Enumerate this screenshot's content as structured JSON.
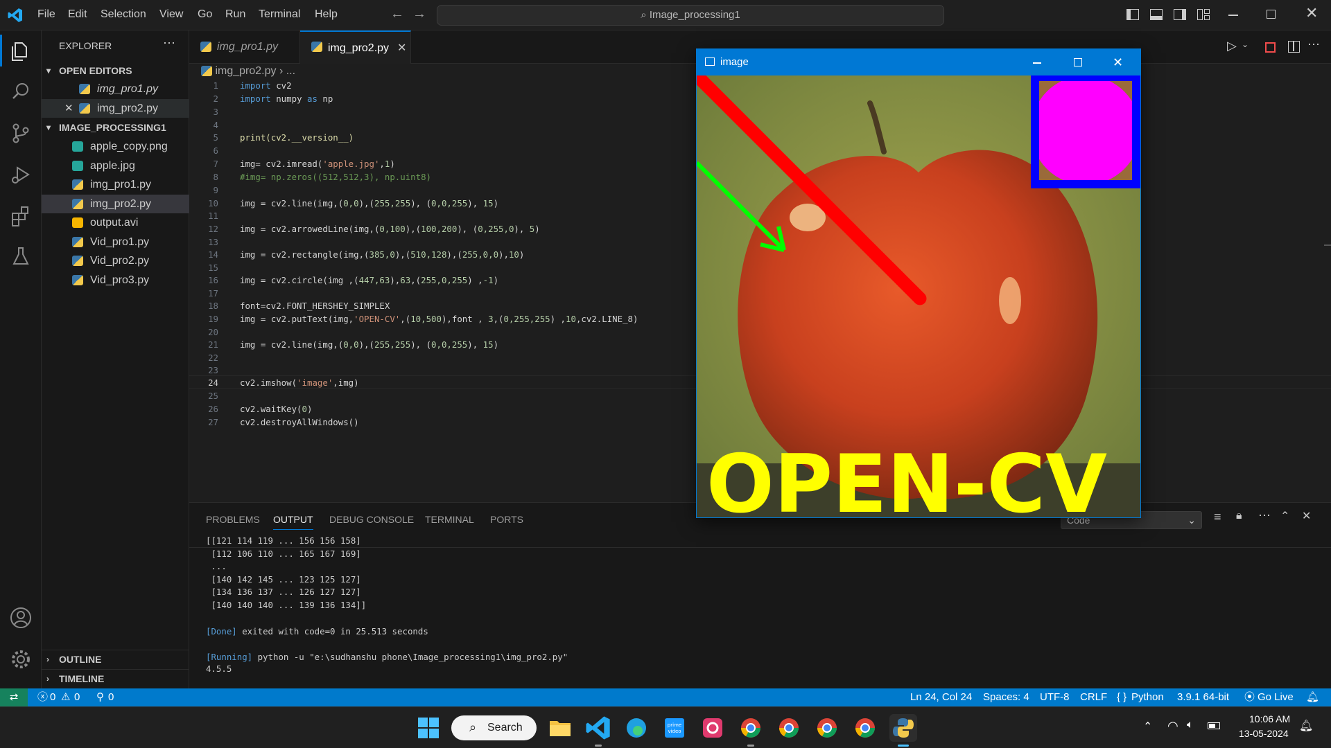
{
  "titlebar": {
    "menu": [
      "File",
      "Edit",
      "Selection",
      "View",
      "Go",
      "Run",
      "Terminal",
      "Help"
    ],
    "search_text": "Image_processing1"
  },
  "sidebar": {
    "header": "EXPLORER",
    "open_editors_label": "OPEN EDITORS",
    "open_editors": [
      "img_pro1.py",
      "img_pro2.py"
    ],
    "project_label": "IMAGE_PROCESSING1",
    "files": [
      "apple_copy.png",
      "apple.jpg",
      "img_pro1.py",
      "img_pro2.py",
      "output.avi",
      "Vid_pro1.py",
      "Vid_pro2.py",
      "Vid_pro3.py"
    ],
    "outline_label": "OUTLINE",
    "timeline_label": "TIMELINE"
  },
  "tabs": [
    {
      "label": "img_pro1.py"
    },
    {
      "label": "img_pro2.py"
    }
  ],
  "breadcrumb": {
    "file": "img_pro2.py",
    "rest": "..."
  },
  "code_lines": [
    {
      "n": "1"
    },
    {
      "n": "2"
    },
    {
      "n": "3"
    },
    {
      "n": "4"
    },
    {
      "n": "5"
    },
    {
      "n": "6"
    },
    {
      "n": "7"
    },
    {
      "n": "8"
    },
    {
      "n": "9"
    },
    {
      "n": "10"
    },
    {
      "n": "11"
    },
    {
      "n": "12"
    },
    {
      "n": "13"
    },
    {
      "n": "14"
    },
    {
      "n": "15"
    },
    {
      "n": "16"
    },
    {
      "n": "17"
    },
    {
      "n": "18"
    },
    {
      "n": "19"
    },
    {
      "n": "20"
    },
    {
      "n": "21"
    },
    {
      "n": "22"
    },
    {
      "n": "23"
    },
    {
      "n": "24"
    },
    {
      "n": "25"
    },
    {
      "n": "26"
    },
    {
      "n": "27"
    }
  ],
  "code": {
    "l1a": "import",
    "l1b": " cv2",
    "l2a": "import",
    "l2b": " numpy ",
    "l2c": "as",
    "l2d": " np",
    "l5": "print(cv2.__version__)",
    "l7a": "img= cv2.imread(",
    "l7b": "'apple.jpg'",
    "l7c": ",",
    "l7d": "1",
    "l7e": ")",
    "l8": "#img= np.zeros((512,512,3), np.uint8)",
    "l10a": "img = cv2.line(img,(",
    "l10b": "0,0",
    "l10c": "),(",
    "l10d": "255,255",
    "l10e": "), (",
    "l10f": "0,0,255",
    "l10g": "), ",
    "l10h": "15",
    "l10i": ")",
    "l12a": "img = cv2.arrowedLine(img,(",
    "l12b": "0,100",
    "l12c": "),(",
    "l12d": "100,200",
    "l12e": "), (",
    "l12f": "0,255,0",
    "l12g": "), ",
    "l12h": "5",
    "l12i": ")",
    "l14a": "img = cv2.rectangle(img,(",
    "l14b": "385,0",
    "l14c": "),(",
    "l14d": "510,128",
    "l14e": "),(",
    "l14f": "255,0,0",
    "l14g": "),",
    "l14h": "10",
    "l14i": ")",
    "l16a": "img = cv2.circle(img ,(",
    "l16b": "447,63",
    "l16c": "),",
    "l16d": "63",
    "l16e": ",(",
    "l16f": "255,0,255",
    "l16g": ") ,",
    "l16h": "-1",
    "l16i": ")",
    "l18": "font=cv2.FONT_HERSHEY_SIMPLEX",
    "l19a": "img = cv2.putText(img,",
    "l19b": "'OPEN-CV'",
    "l19c": ",(",
    "l19d": "10,500",
    "l19e": "),font , ",
    "l19f": "3",
    "l19g": ",(",
    "l19h": "0,255,255",
    "l19i": ") ,",
    "l19j": "10",
    "l19k": ",cv2.LINE_8)",
    "l21a": "img = cv2.line(img,(",
    "l21b": "0,0",
    "l21c": "),(",
    "l21d": "255,255",
    "l21e": "), (",
    "l21f": "0,0,255",
    "l21g": "), ",
    "l21h": "15",
    "l21i": ")",
    "l24a": "cv2.imshow(",
    "l24b": "'image'",
    "l24c": ",img)",
    "l26a": "cv2.waitKey(",
    "l26b": "0",
    "l26c": ")",
    "l27": "cv2.destroyAllWindows()"
  },
  "panel": {
    "tabs": [
      "PROBLEMS",
      "OUTPUT",
      "DEBUG CONSOLE",
      "TERMINAL",
      "PORTS"
    ],
    "dropdown": "Code",
    "output_lines": [
      "[[121 114 119 ... 156 156 158]",
      " [112 106 110 ... 165 167 169]",
      " ...",
      " [140 142 145 ... 123 125 127]",
      " [134 136 137 ... 126 127 127]",
      " [140 140 140 ... 139 136 134]]",
      "",
      "",
      "",
      "",
      "4.5.5"
    ],
    "done_tag": "[Done]",
    "done_text": " exited with code=0 in 25.513 seconds",
    "running_tag": "[Running]",
    "running_text": " python -u \"e:\\sudhanshu phone\\Image_processing1\\img_pro2.py\""
  },
  "statusbar": {
    "errors": "0",
    "warnings": "0",
    "ports": "0",
    "position": "Ln 24, Col 24",
    "spaces": "Spaces: 4",
    "encoding": "UTF-8",
    "eol": "CRLF",
    "language": "Python",
    "interpreter": "3.9.1 64-bit",
    "golive": "Go Live"
  },
  "cv_window": {
    "title": "image",
    "overlay_text": "OPEN-CV"
  },
  "taskbar": {
    "search_label": "Search",
    "time": "10:06 AM",
    "date": "13-05-2024"
  },
  "colors": {
    "accent": "#007acc",
    "window_title": "#0078d4",
    "line_red": "#ff0000",
    "arrow_green": "#00ff00",
    "rect_blue": "#0000ff",
    "circle_magenta": "#ff00ff",
    "text_yellow": "#ffff00"
  }
}
